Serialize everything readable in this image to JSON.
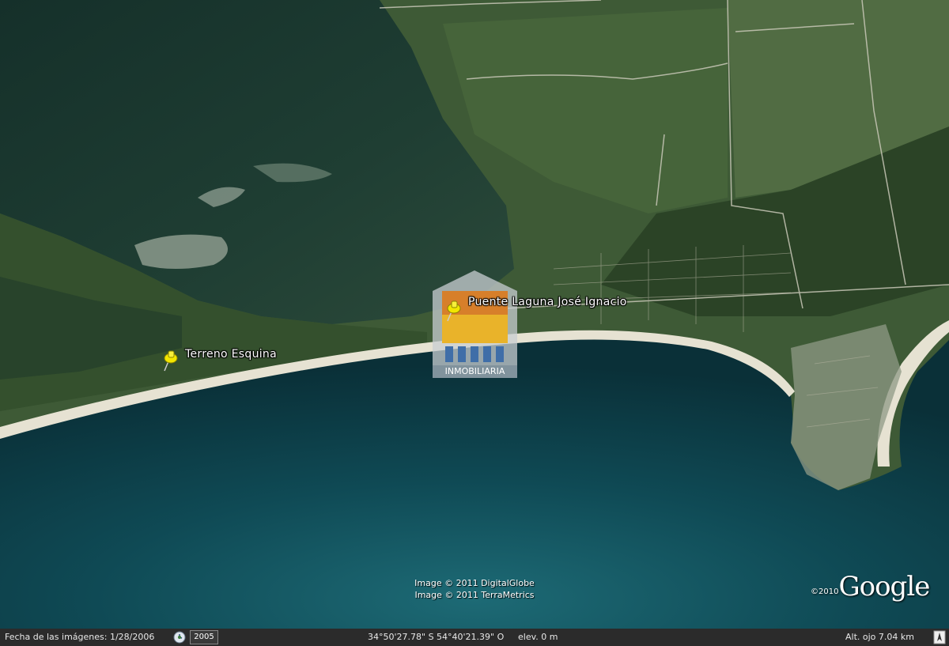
{
  "placemarks": [
    {
      "id": "terreno",
      "label": "Terreno Esquina",
      "icon": "yellow-pushpin-icon"
    },
    {
      "id": "puente",
      "label": "Puente Laguna José Ignacio",
      "icon": "yellow-pushpin-icon"
    }
  ],
  "watermark": {
    "label": "INMOBILIARIA"
  },
  "credits": {
    "line1": "Image © 2011 DigitalGlobe",
    "line2": "Image © 2011 TerraMetrics"
  },
  "logo": {
    "year": "©2010",
    "word": "Google"
  },
  "statusbar": {
    "imagery_date": "Fecha de las imágenes: 1/28/2006",
    "historical_year": "2005",
    "coordinates": "34°50'27.78\" S  54°40'21.39\" O",
    "elevation": "elev.     0 m",
    "eye_alt": "Alt. ojo     7.04 km"
  },
  "colors": {
    "ocean": "#0f4650",
    "lagoon": "#24463a",
    "land": "#3e5a36",
    "beach": "#e6e2d2",
    "pin": "#f2e600"
  }
}
